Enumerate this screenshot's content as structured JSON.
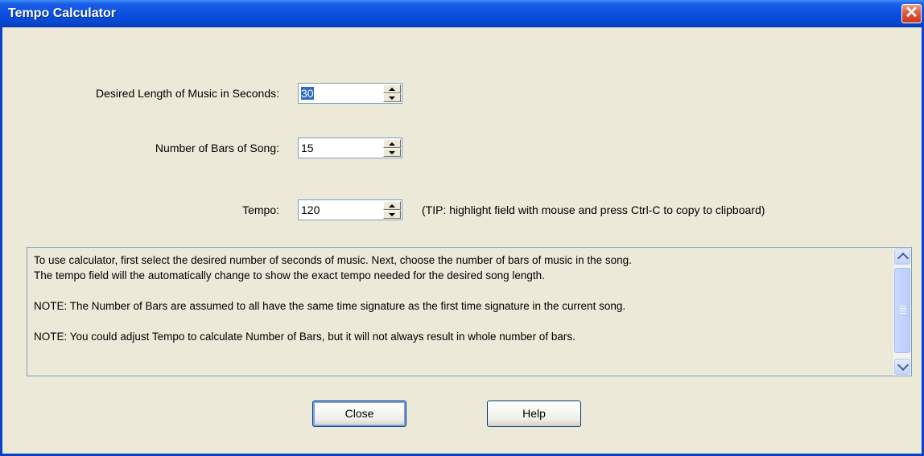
{
  "window": {
    "title": "Tempo Calculator",
    "close_glyph": "✕"
  },
  "fields": {
    "seconds": {
      "label": "Desired Length of Music in Seconds:",
      "value": "30"
    },
    "bars": {
      "label": "Number of Bars of Song:",
      "value": "15"
    },
    "tempo": {
      "label": "Tempo:",
      "value": "120"
    }
  },
  "tip": "(TIP: highlight field with mouse and press Ctrl-C to copy to clipboard)",
  "info": {
    "line1": "To use calculator, first select the desired number of seconds of music.  Next, choose the number of bars of music in the song.",
    "line2": "The tempo field will the automatically change to show the exact tempo needed for the desired song length.",
    "line3": "NOTE: The Number of Bars are assumed to all have the same time signature as the first time signature in the current song.",
    "line4": "NOTE: You could adjust Tempo to calculate Number of Bars, but it will not always result in whole number of bars."
  },
  "buttons": {
    "close": "Close",
    "help": "Help"
  },
  "colors": {
    "titlebar": "#0a4fe0",
    "dialog_bg": "#ece9d8",
    "close_button": "#e0583a",
    "selection": "#316ac5"
  }
}
